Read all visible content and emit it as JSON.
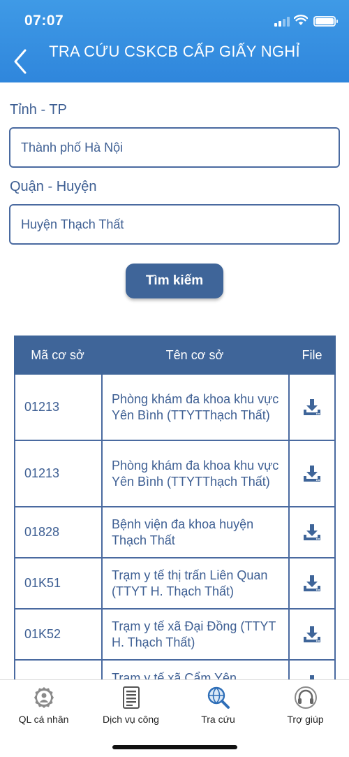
{
  "status_bar": {
    "time": "07:07"
  },
  "header": {
    "title": "TRA CỨU CSKCB CẤP GIẤY NGHỈ"
  },
  "form": {
    "province_label": "Tỉnh - TP",
    "province_value": "Thành phố Hà Nội",
    "district_label": "Quận - Huyện",
    "district_value": "Huyện Thạch Thất",
    "search_button": "Tìm kiếm"
  },
  "table": {
    "columns": [
      "Mã cơ sở",
      "Tên cơ sở",
      "File"
    ],
    "rows": [
      {
        "code": "01213",
        "name": "Phòng khám đa khoa khu vực Yên Bình  (TTYTThạch Thất)"
      },
      {
        "code": "01213",
        "name": "Phòng khám đa khoa khu vực Yên Bình  (TTYTThạch Thất)"
      },
      {
        "code": "01828",
        "name": "Bệnh viện đa khoa huyện Thạch Thất"
      },
      {
        "code": "01K51",
        "name": "Trạm y tế thị trấn Liên Quan (TTYT H. Thạch Thất)"
      },
      {
        "code": "01K52",
        "name": "Trạm y tế xã Đại Đồng (TTYT H. Thạch Thất)"
      },
      {
        "code": "",
        "name": "Trạm y tế xã Cẩm Yên"
      }
    ],
    "file_icon": "download-icon"
  },
  "tab_bar": {
    "tabs": [
      {
        "label": "QL cá nhân",
        "icon": "user-gear-icon"
      },
      {
        "label": "Dịch vụ công",
        "icon": "document-icon"
      },
      {
        "label": "Tra cứu",
        "icon": "globe-search-icon",
        "active": true
      },
      {
        "label": "Trợ giúp",
        "icon": "headset-icon"
      }
    ]
  },
  "colors": {
    "header": "#2f86dc",
    "primary": "#3f6599",
    "text": "#3e5f93"
  }
}
